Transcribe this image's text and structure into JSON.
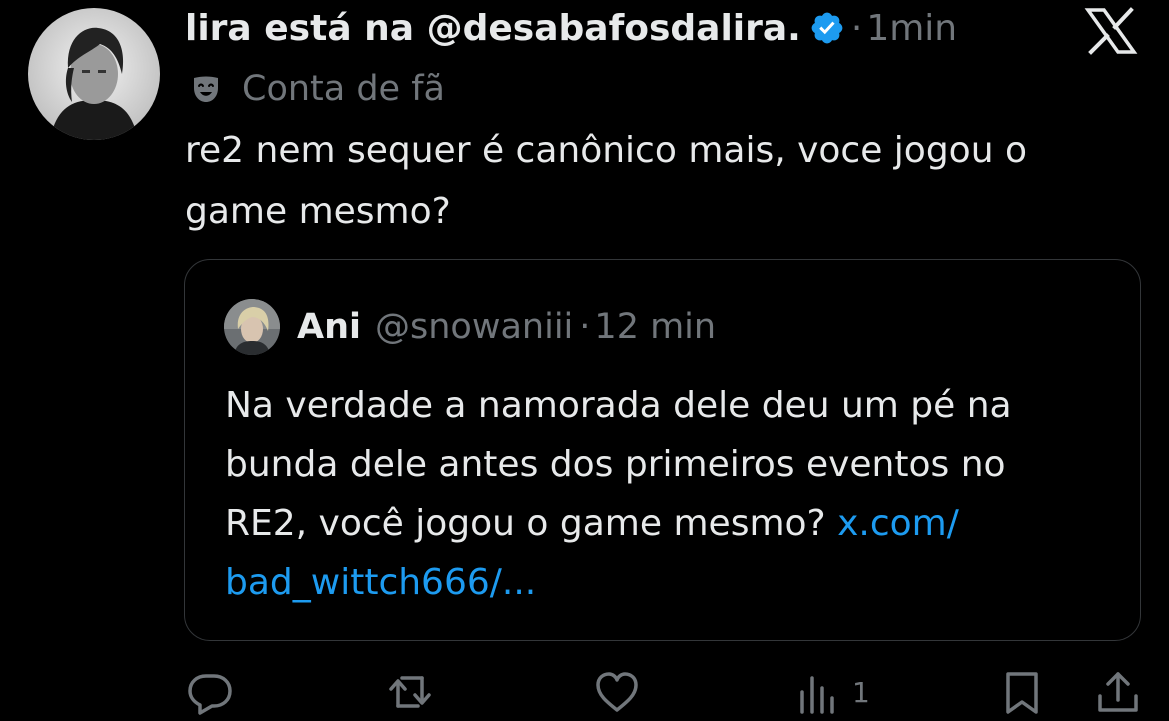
{
  "author": {
    "display_name": "lira está na @desabafosdalira.",
    "time": "1min",
    "separator": "·",
    "label": "Conta de fã"
  },
  "tweet": {
    "text_line1": "re2 nem sequer é canônico mais, voce jogou o",
    "text_line2": "game mesmo?"
  },
  "quote": {
    "name": "Ani",
    "handle": "@snowaniii",
    "separator": "·",
    "time": "12 min",
    "text_line1": "Na verdade a namorada dele deu um pé na",
    "text_line2": "bunda dele antes dos primeiros eventos no",
    "text_line3_plain": "RE2, você jogou o game mesmo? ",
    "link_part1": "x.com/",
    "link_part2": "bad_wittch666/..."
  },
  "actions": {
    "views_count": "1"
  },
  "icons": {
    "verified": "verified-badge-icon",
    "label": "theater-mask-icon",
    "brand": "x-logo-icon",
    "reply": "reply-icon",
    "repost": "repost-icon",
    "like": "heart-icon",
    "views": "analytics-icon",
    "bookmark": "bookmark-icon",
    "share": "share-icon"
  },
  "colors": {
    "background": "#000000",
    "text": "#e7e9ea",
    "secondary": "#71767b",
    "link": "#1d9bf0",
    "verified": "#1d9bf0",
    "border": "#333639"
  }
}
